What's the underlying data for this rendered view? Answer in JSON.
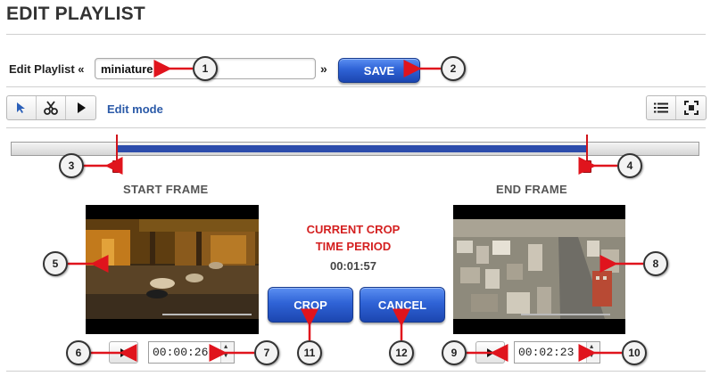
{
  "page": {
    "title": "EDIT PLAYLIST"
  },
  "editor": {
    "label": "Edit Playlist «",
    "name_value": "miniature",
    "separator": "»",
    "save_label": "SAVE"
  },
  "toolbar": {
    "tools": [
      {
        "name": "select-tool",
        "icon": "cursor-arrow-icon"
      },
      {
        "name": "cut-tool",
        "icon": "scissors-icon"
      },
      {
        "name": "play-tool",
        "icon": "play-icon"
      }
    ],
    "mode_label": "Edit mode",
    "right_tools": [
      {
        "name": "list-view",
        "icon": "list-icon"
      },
      {
        "name": "fullscreen",
        "icon": "fullscreen-icon"
      }
    ]
  },
  "timeline": {
    "start_fraction": 0.154,
    "end_fraction": 0.837
  },
  "start_frame": {
    "label": "START FRAME",
    "time": "00:00:26",
    "image": "night city street with parked cars"
  },
  "end_frame": {
    "label": "END FRAME",
    "time": "00:02:23",
    "image": "aerial view of city buildings"
  },
  "crop_info": {
    "line1": "CURRENT CROP",
    "line2": "TIME PERIOD",
    "duration": "00:01:57",
    "crop_label": "CROP",
    "cancel_label": "CANCEL"
  },
  "callouts": [
    "1",
    "2",
    "3",
    "4",
    "5",
    "6",
    "7",
    "8",
    "9",
    "10",
    "11",
    "12"
  ],
  "colors": {
    "accent_blue": "#2f63d6",
    "timeline_fill": "#2c4cab",
    "marker_red": "#e0141d",
    "crop_text_red": "#d42020",
    "edit_mode_blue": "#2b5aa8"
  }
}
